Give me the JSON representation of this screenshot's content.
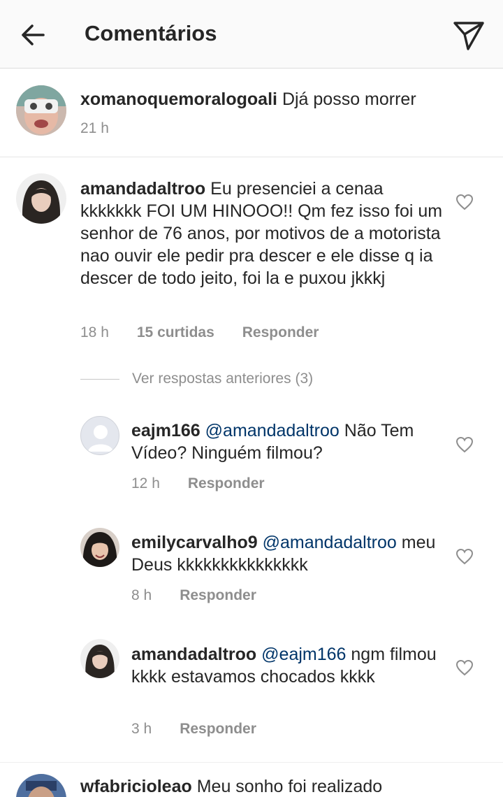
{
  "header": {
    "title": "Comentários"
  },
  "caption": {
    "username": "xomanoquemoralogoali",
    "text": "Djá posso morrer",
    "time": "21 h"
  },
  "comment": {
    "username": "amandadaltroo",
    "text": "Eu presenciei a cenaa kkkkkkk FOI UM HINOOO!! Qm fez isso foi um senhor de 76 anos, por motivos de a motorista nao ouvir ele pedir pra descer e ele disse q ia descer de todo jeito, foi la e puxou jkkkj",
    "time": "18 h",
    "likes": "15 curtidas",
    "reply": "Responder"
  },
  "view_previous": "Ver respostas anteriores (3)",
  "replies": [
    {
      "username": "eajm166",
      "mention": "@amandadaltroo",
      "text": "Não Tem Vídeo? Ninguém filmou?",
      "time": "12 h",
      "reply": "Responder"
    },
    {
      "username": "emilycarvalho9",
      "mention": "@amandadaltroo",
      "text": "meu Deus kkkkkkkkkkkkkkk",
      "time": "8 h",
      "reply": "Responder"
    },
    {
      "username": "amandadaltroo",
      "mention": "@eajm166",
      "text": " ngm filmou kkkk estavamos chocados kkkk",
      "time": "3 h",
      "reply": "Responder"
    }
  ],
  "next_comment": {
    "username": "wfabricioleao",
    "text": "Meu sonho foi realizado"
  }
}
